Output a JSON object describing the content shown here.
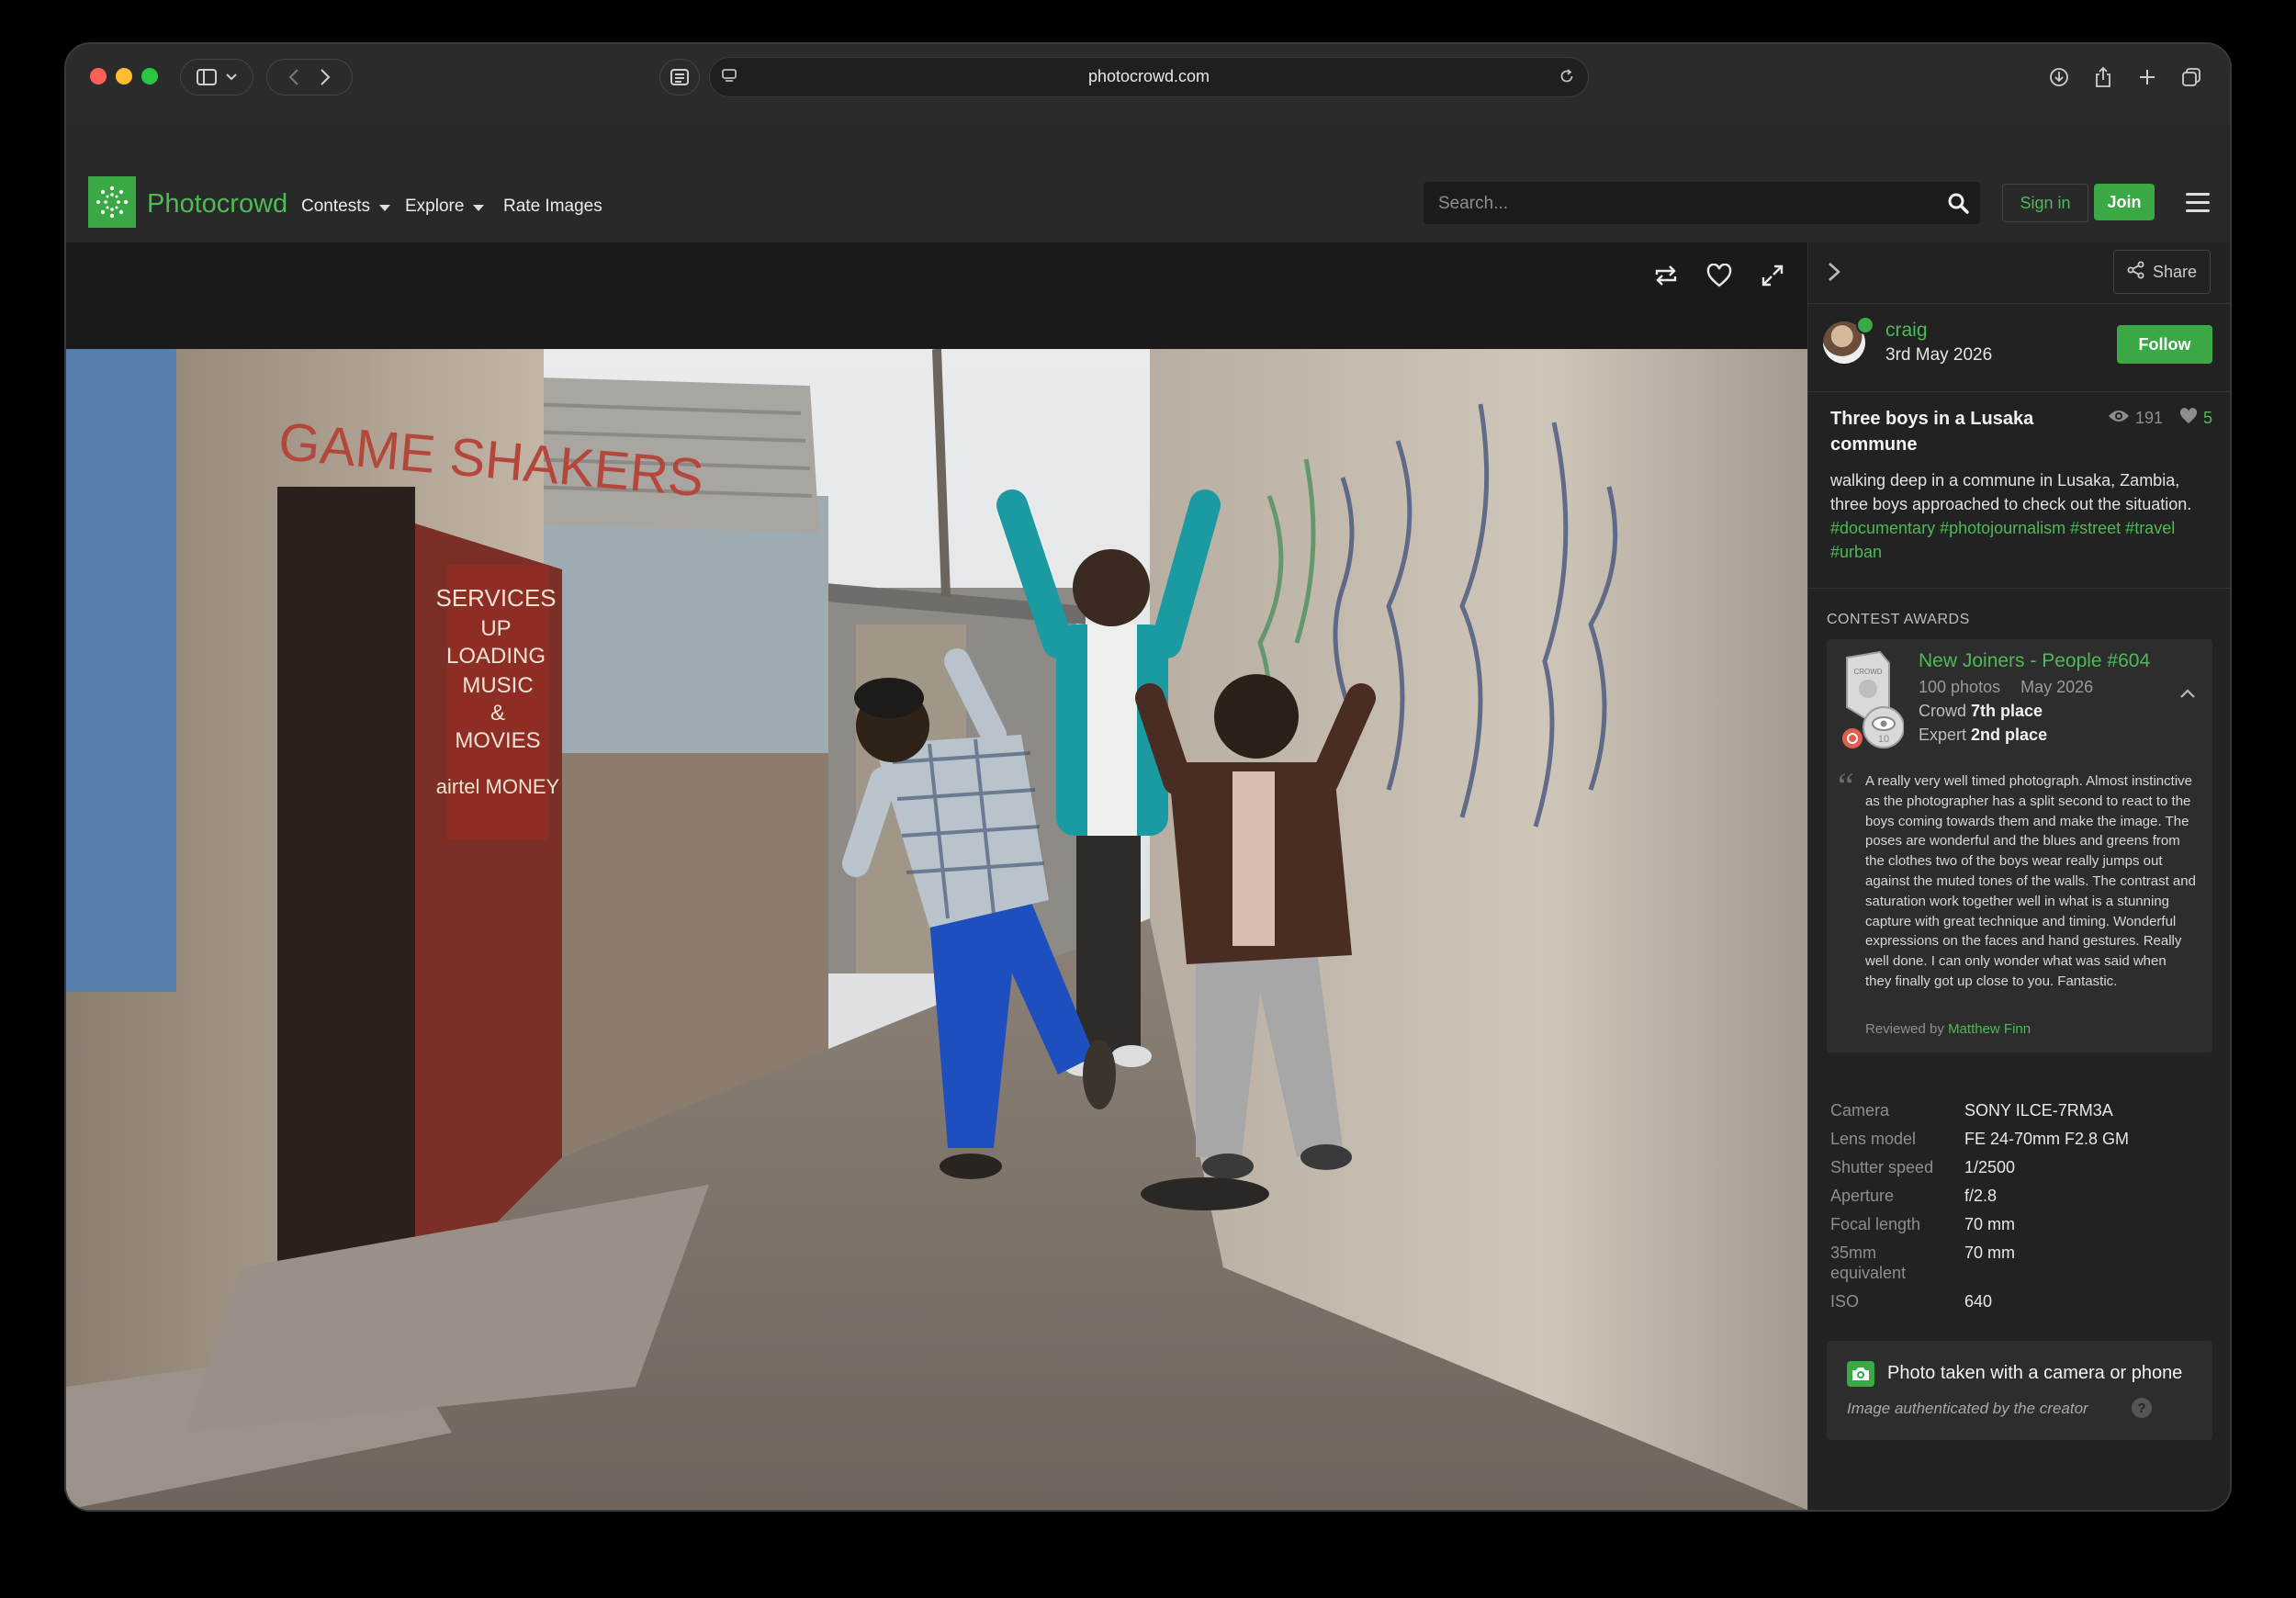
{
  "browser": {
    "url": "photocrowd.com"
  },
  "site": {
    "brand": "Photocrowd",
    "nav": [
      "Contests",
      "Explore",
      "Rate Images"
    ],
    "search_placeholder": "Search...",
    "signin": "Sign in",
    "join": "Join"
  },
  "sidebar": {
    "share": "Share",
    "author": {
      "name": "craig",
      "date": "3rd May 2026",
      "follow": "Follow"
    },
    "photo": {
      "title": "Three boys in a Lusaka commune",
      "views": "191",
      "likes": "5",
      "description": "walking deep in a commune in Lusaka, Zambia, three boys approached to check out the situation.",
      "tags": "#documentary #photojournalism #street #travel #urban"
    },
    "awards_label": "CONTEST AWARDS",
    "award": {
      "title": "New Joiners - People #604",
      "photos": "100 photos",
      "month": "May 2026",
      "crowd_label": "Crowd",
      "crowd_place": "7th place",
      "expert_label": "Expert",
      "expert_place": "2nd place",
      "review": "A really very well timed photograph. Almost instinctive as the photographer has a split second to react to the boys coming towards them and make the image. The poses are wonderful and the blues and greens from the clothes two of the boys wear really jumps out against the muted tones of the walls. The contrast and saturation work together well in what is a stunning capture with great technique and timing. Wonderful expressions on the faces and hand gestures. Really well done. I can only wonder what was said when they finally got up close to you. Fantastic.",
      "reviewed_by_label": "Reviewed by",
      "reviewer": "Matthew Finn",
      "badge_label": "CROWD",
      "badge_number": "10"
    },
    "exif": [
      {
        "k": "Camera",
        "v": "SONY ILCE-7RM3A"
      },
      {
        "k": "Lens model",
        "v": "FE 24-70mm F2.8 GM"
      },
      {
        "k": "Shutter speed",
        "v": "1/2500"
      },
      {
        "k": "Aperture",
        "v": "f/2.8"
      },
      {
        "k": "Focal length",
        "v": "70 mm"
      },
      {
        "k": "35mm equivalent",
        "v": "70 mm"
      },
      {
        "k": "ISO",
        "v": "640"
      }
    ],
    "auth": {
      "title": "Photo taken with a camera or phone",
      "subtitle": "Image authenticated by the creator",
      "help": "?"
    }
  },
  "photo_signs": {
    "shop_sign": "GAME SHAKERS",
    "door_sign_1": "SERVICES",
    "door_sign_2": "UP",
    "door_sign_3": "LOADING",
    "door_sign_4": "MUSIC",
    "door_sign_5": "&",
    "door_sign_6": "MOVIES",
    "door_sign_7": "airtel MONEY"
  },
  "colors": {
    "accent": "#3aa845",
    "accent_text": "#4cbb55"
  }
}
